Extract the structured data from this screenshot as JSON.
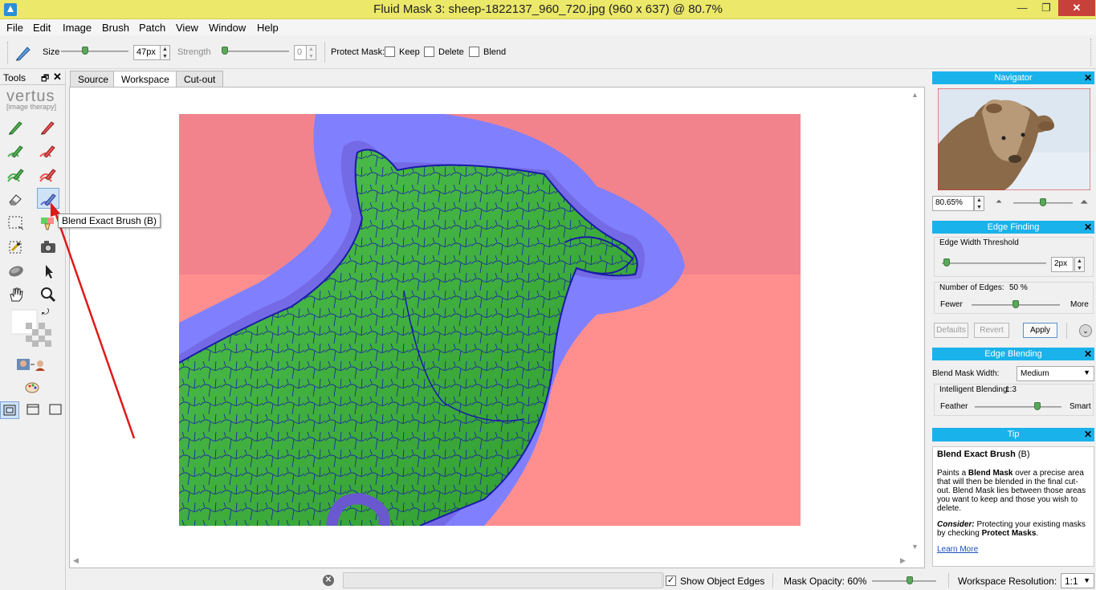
{
  "window": {
    "title": "Fluid Mask 3: sheep-1822137_960_720.jpg (960 x 637) @ 80.7%",
    "min_glyph": "—",
    "max_glyph": "❐",
    "close_glyph": "✕"
  },
  "menu": [
    "File",
    "Edit",
    "Image",
    "Brush",
    "Patch",
    "View",
    "Window",
    "Help"
  ],
  "toolbar": {
    "size_label": "Size",
    "size_value": "47px",
    "size_level": 0.35,
    "strength_label": "Strength",
    "strength_value": "0",
    "strength_level": 0.0,
    "protect_label": "Protect Mask:",
    "keep_label": "Keep",
    "keep_checked": false,
    "delete_label": "Delete",
    "delete_checked": false,
    "blend_label": "Blend",
    "blend_checked": false
  },
  "tools_panel": {
    "title": "Tools",
    "pin_glyph": "🗗",
    "close_glyph": "✕",
    "brand": "vertus",
    "brand_sub": "[image therapy]",
    "tooltip": "Blend Exact Brush (B)",
    "tools": [
      "keep-brush-icon",
      "delete-brush-icon",
      "keep-exact-brush-icon",
      "delete-exact-brush-icon",
      "keep-local-brush-icon",
      "delete-local-brush-icon",
      "eraser-icon",
      "blend-exact-brush-icon",
      "patch-select-icon",
      "fill-icon",
      "magic-select-icon",
      "camera-icon",
      "hand-eraser-icon",
      "pointer-icon",
      "pan-hand-icon",
      "zoom-icon",
      "swap-icon",
      "color-swatch-icon",
      "compare-view-icon",
      "palette-icon",
      "view-mode-1-icon",
      "view-mode-2-icon",
      "view-mode-3-icon"
    ]
  },
  "tabs": [
    {
      "label": "Source",
      "active": false
    },
    {
      "label": "Workspace",
      "active": true
    },
    {
      "label": "Cut-out",
      "active": false
    }
  ],
  "navigator": {
    "title": "Navigator",
    "zoom_value": "80.65%",
    "zoom_level": 0.5
  },
  "edge_finding": {
    "title": "Edge Finding",
    "threshold_label": "Edge Width Threshold",
    "threshold_value": "2px",
    "threshold_level": 0.02,
    "edges_label": "Number of Edges:",
    "edges_value": "50 %",
    "edges_level": 0.5,
    "fewer_label": "Fewer",
    "more_label": "More",
    "defaults_btn": "Defaults",
    "revert_btn": "Revert",
    "apply_btn": "Apply"
  },
  "edge_blending": {
    "title": "Edge Blending",
    "width_label": "Blend Mask Width:",
    "width_value": "Medium",
    "intelligent_label": "Intelligent Blending:",
    "intelligent_value": "1:3",
    "feather_label": "Feather",
    "smart_label": "Smart",
    "blend_level": 0.75
  },
  "tip": {
    "title": "Tip",
    "heading": "Blend Exact Brush",
    "heading_suffix": " (B)",
    "p1_a": "Paints a ",
    "p1_b": "Blend Mask",
    "p1_c": " over a precise area that will then be blended in the final cut-out. Blend Mask lies between those areas you want to keep and those you wish to delete.",
    "p2_a": "Consider:",
    "p2_b": " Protecting your existing masks by checking ",
    "p2_c": "Protect Masks",
    "p2_d": ".",
    "link": "Learn More"
  },
  "statusbar": {
    "show_edges_label": "Show Object Edges",
    "show_edges_checked": true,
    "mask_opacity_label": "Mask Opacity: 60%",
    "mask_opacity_level": 0.6,
    "resolution_label": "Workspace Resolution:",
    "resolution_value": "1:1"
  },
  "colors": {
    "title_bar": "#ebe86a",
    "panel_header": "#1ab2ea",
    "keep_mask": "#5fd35f",
    "delete_mask": "#ff8a8a",
    "blend_mask": "#8080ff",
    "edge_lines": "#1a1aa8",
    "annotation_arrow": "#e01818"
  }
}
